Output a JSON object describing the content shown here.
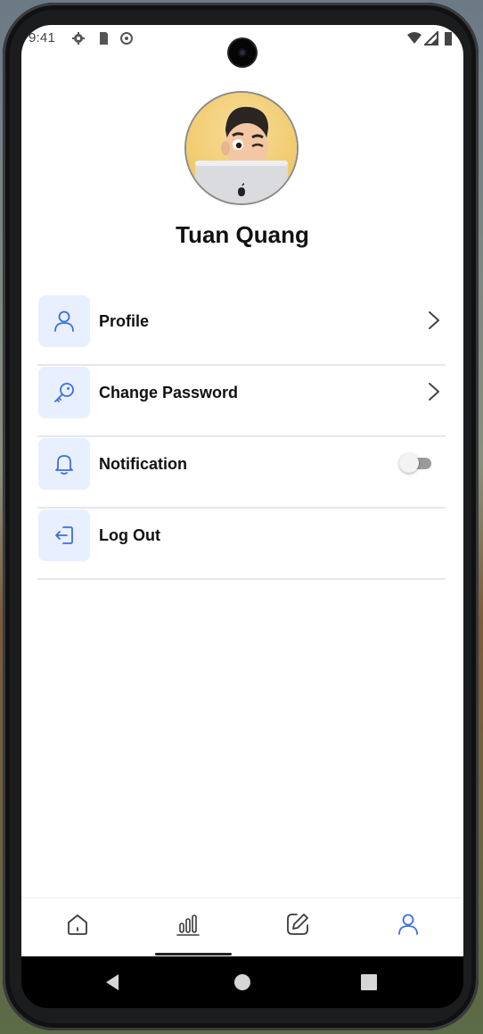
{
  "status_bar": {
    "time": "9:41"
  },
  "profile": {
    "name": "Tuan Quang"
  },
  "menu": [
    {
      "label": "Profile",
      "icon": "user-icon",
      "trailing": "chevron"
    },
    {
      "label": "Change Password",
      "icon": "key-icon",
      "trailing": "chevron"
    },
    {
      "label": "Notification",
      "icon": "bell-icon",
      "trailing": "toggle",
      "enabled": false
    },
    {
      "label": "Log Out",
      "icon": "logout-icon",
      "trailing": "none"
    }
  ],
  "tabbar": {
    "items": [
      "home-icon",
      "stats-icon",
      "edit-icon",
      "profile-icon"
    ],
    "active_index": 3
  },
  "colors": {
    "accent": "#3b6fe0",
    "icon_bg": "#e8efff",
    "inactive_icon": "#3a3a3a",
    "divider": "#e6e7ea"
  }
}
